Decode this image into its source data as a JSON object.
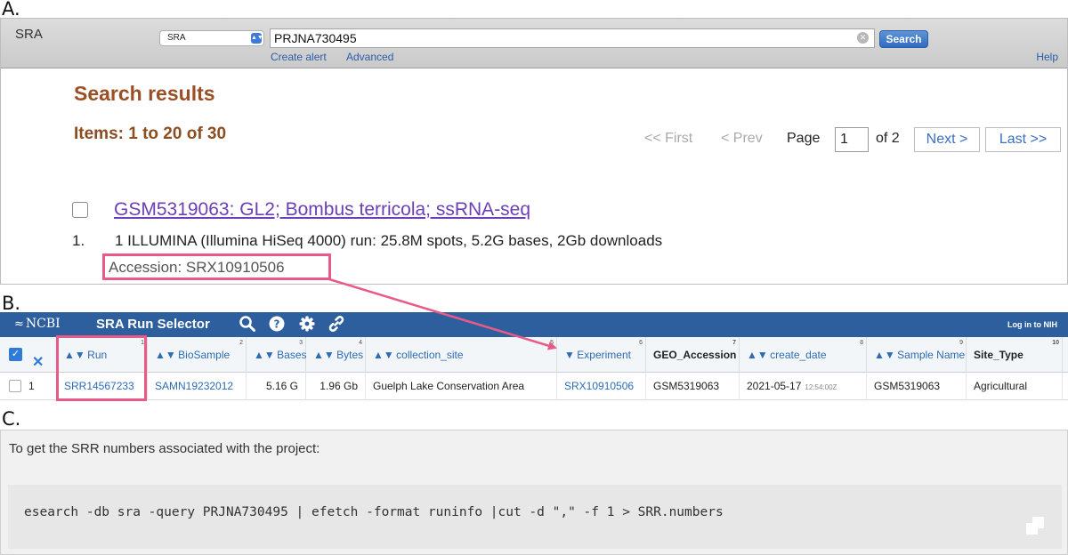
{
  "panel_labels": {
    "a": "A.",
    "b": "B.",
    "c": "C."
  },
  "panel_a": {
    "logo": "SRA",
    "db_select": {
      "value": "SRA",
      "arrow_icon": "select-arrow-icon"
    },
    "search": {
      "value": "PRJNA730495",
      "button": "Search"
    },
    "links": {
      "create_alert": "Create alert",
      "advanced": "Advanced",
      "help": "Help"
    },
    "results_title": "Search results",
    "items_count": "Items: 1 to 20 of 30",
    "pager": {
      "first": "<< First",
      "prev": "< Prev",
      "page_label": "Page",
      "page_value": "1",
      "of": "of 2",
      "next": "Next >",
      "last": "Last >>"
    },
    "result": {
      "number": "1.",
      "title": "GSM5319063: GL2; Bombus terricola; ssRNA-seq",
      "description": "1 ILLUMINA (Illumina HiSeq 4000) run: 25.8M spots, 5.2G bases, 2Gb downloads",
      "accession": "Accession: SRX10910506"
    }
  },
  "panel_b": {
    "logo": "NCBI",
    "app_title": "SRA Run Selector",
    "login": "Log in to NIH",
    "header_color": "#2d5f9e",
    "columns": [
      {
        "label": "Run",
        "idx": "1"
      },
      {
        "label": "BioSample",
        "idx": "2"
      },
      {
        "label": "Bases",
        "idx": "3"
      },
      {
        "label": "Bytes",
        "idx": "4"
      },
      {
        "label": "collection_site",
        "idx": "5"
      },
      {
        "label": "Experiment",
        "idx": "6"
      },
      {
        "label": "GEO_Accession",
        "idx": "7"
      },
      {
        "label": "create_date",
        "idx": "8"
      },
      {
        "label": "Sample Name",
        "idx": "9"
      },
      {
        "label": "Site_Type",
        "idx": "10"
      }
    ],
    "row": {
      "num": "1",
      "run": "SRR14567233",
      "biosample": "SAMN19232012",
      "bases": "5.16 G",
      "bytes": "1.96 Gb",
      "collection_site": "Guelph Lake Conservation Area",
      "experiment": "SRX10910506",
      "geo_accession": "GSM5319063",
      "create_date": "2021-05-17",
      "create_time": "12:54:00Z",
      "sample_name": "GSM5319063",
      "site_type": "Agricultural"
    }
  },
  "panel_c": {
    "intro": "To get the SRR numbers associated with the project:",
    "code": "esearch -db sra -query PRJNA730495 | efetch -format runinfo |cut -d \",\" -f 1 > SRR.numbers"
  },
  "highlight_color": "#e75b86"
}
